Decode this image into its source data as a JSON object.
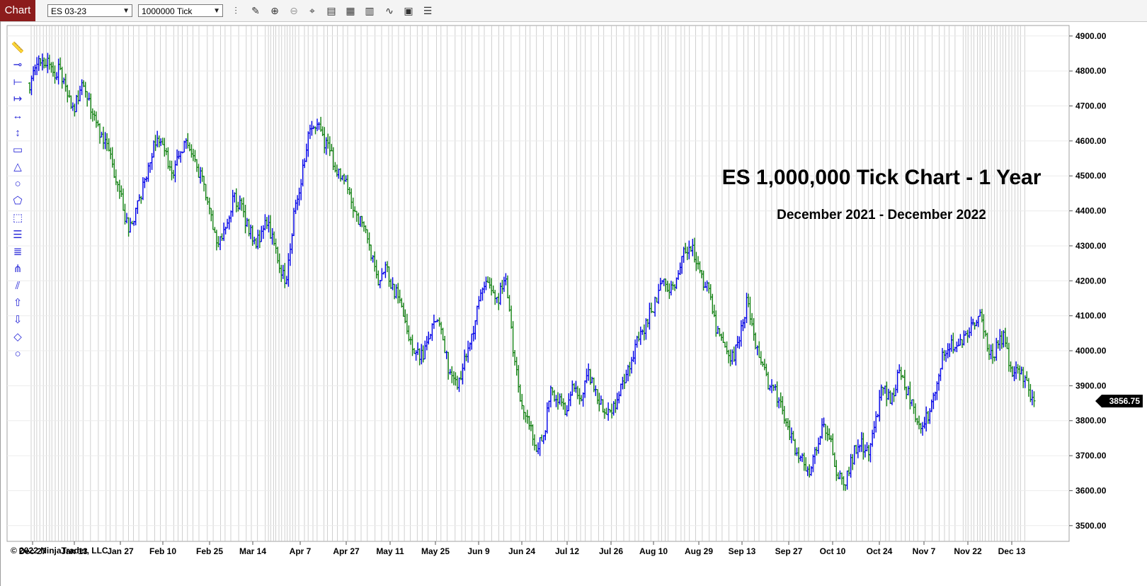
{
  "toolbar": {
    "tab_label": "Chart",
    "instrument": "ES 03-23",
    "interval": "1000000 Tick",
    "icons": [
      "bar-style-icon",
      "pencil-icon",
      "zoom-in-icon",
      "zoom-out-icon",
      "crosshair-icon",
      "properties-icon",
      "data-box-icon",
      "strategies-icon",
      "indicators-icon",
      "screenshot-icon",
      "menu-icon"
    ]
  },
  "drawing_tools": [
    "ruler-icon",
    "risk-reward-icon",
    "line-icon",
    "ray-icon",
    "extended-line-icon",
    "arrow-line-icon",
    "rectangle-icon",
    "triangle-icon",
    "ellipse-icon",
    "polygon-icon",
    "region-icon",
    "fibonacci-retracement-icon",
    "fibonacci-extension-icon",
    "andrews-pitchfork-icon",
    "parallel-lines-icon",
    "arrow-up-icon",
    "arrow-down-icon",
    "diamond-icon",
    "circle-icon"
  ],
  "title": "ES 1,000,000 Tick Chart - 1 Year",
  "subtitle": "December 2021 - December 2022",
  "copyright": "© 2022 NinjaTrader, LLC",
  "last_price": "3856.75",
  "colors": {
    "up": "#0000e8",
    "down": "#148214",
    "grid": "#c4c4c4",
    "tab": "#8c1c1c"
  },
  "chart_data": {
    "type": "bar",
    "instrument": "ES 03-23",
    "ylim": [
      3455,
      4930
    ],
    "y_ticks": [
      "4900.00",
      "4800.00",
      "4700.00",
      "4600.00",
      "4500.00",
      "4400.00",
      "4300.00",
      "4200.00",
      "4100.00",
      "4000.00",
      "3900.00",
      "3800.00",
      "3700.00",
      "3600.00",
      "3500.00"
    ],
    "x_labels": [
      "Dec 27",
      "Jan 13",
      "Jan 27",
      "Feb 10",
      "Feb 25",
      "Mar 14",
      "Apr 7",
      "Apr 27",
      "May 11",
      "May 25",
      "Jun 9",
      "Jun 24",
      "Jul 12",
      "Jul 26",
      "Aug 10",
      "Aug 29",
      "Sep 13",
      "Sep 27",
      "Oct 10",
      "Oct 24",
      "Nov 7",
      "Nov 22",
      "Dec 13"
    ],
    "close_path": [
      4765,
      4830,
      4835,
      4790,
      4810,
      4720,
      4700,
      4760,
      4700,
      4640,
      4600,
      4530,
      4450,
      4350,
      4390,
      4470,
      4560,
      4620,
      4560,
      4500,
      4570,
      4600,
      4520,
      4480,
      4390,
      4300,
      4350,
      4440,
      4410,
      4350,
      4300,
      4360,
      4340,
      4230,
      4200,
      4400,
      4500,
      4620,
      4660,
      4600,
      4560,
      4500,
      4480,
      4400,
      4360,
      4300,
      4200,
      4250,
      4180,
      4150,
      4050,
      4000,
      3980,
      4050,
      4100,
      4000,
      3900,
      3920,
      4000,
      4080,
      4200,
      4180,
      4150,
      4210,
      4000,
      3860,
      3800,
      3720,
      3750,
      3880,
      3860,
      3820,
      3900,
      3860,
      3930,
      3870,
      3840,
      3820,
      3880,
      3940,
      4000,
      4050,
      4100,
      4150,
      4200,
      4180,
      4230,
      4300,
      4280,
      4200,
      4180,
      4050,
      4000,
      3980,
      4030,
      4150,
      4020,
      3950,
      3900,
      3870,
      3800,
      3740,
      3700,
      3650,
      3700,
      3800,
      3750,
      3640,
      3620,
      3700,
      3750,
      3700,
      3800,
      3900,
      3850,
      3930,
      3900,
      3850,
      3760,
      3820,
      3880,
      4000,
      4030,
      4000,
      4050,
      4080,
      4110,
      3970,
      4010,
      4040,
      3940,
      3950,
      3900,
      3856.75
    ],
    "last": 3856.75
  }
}
